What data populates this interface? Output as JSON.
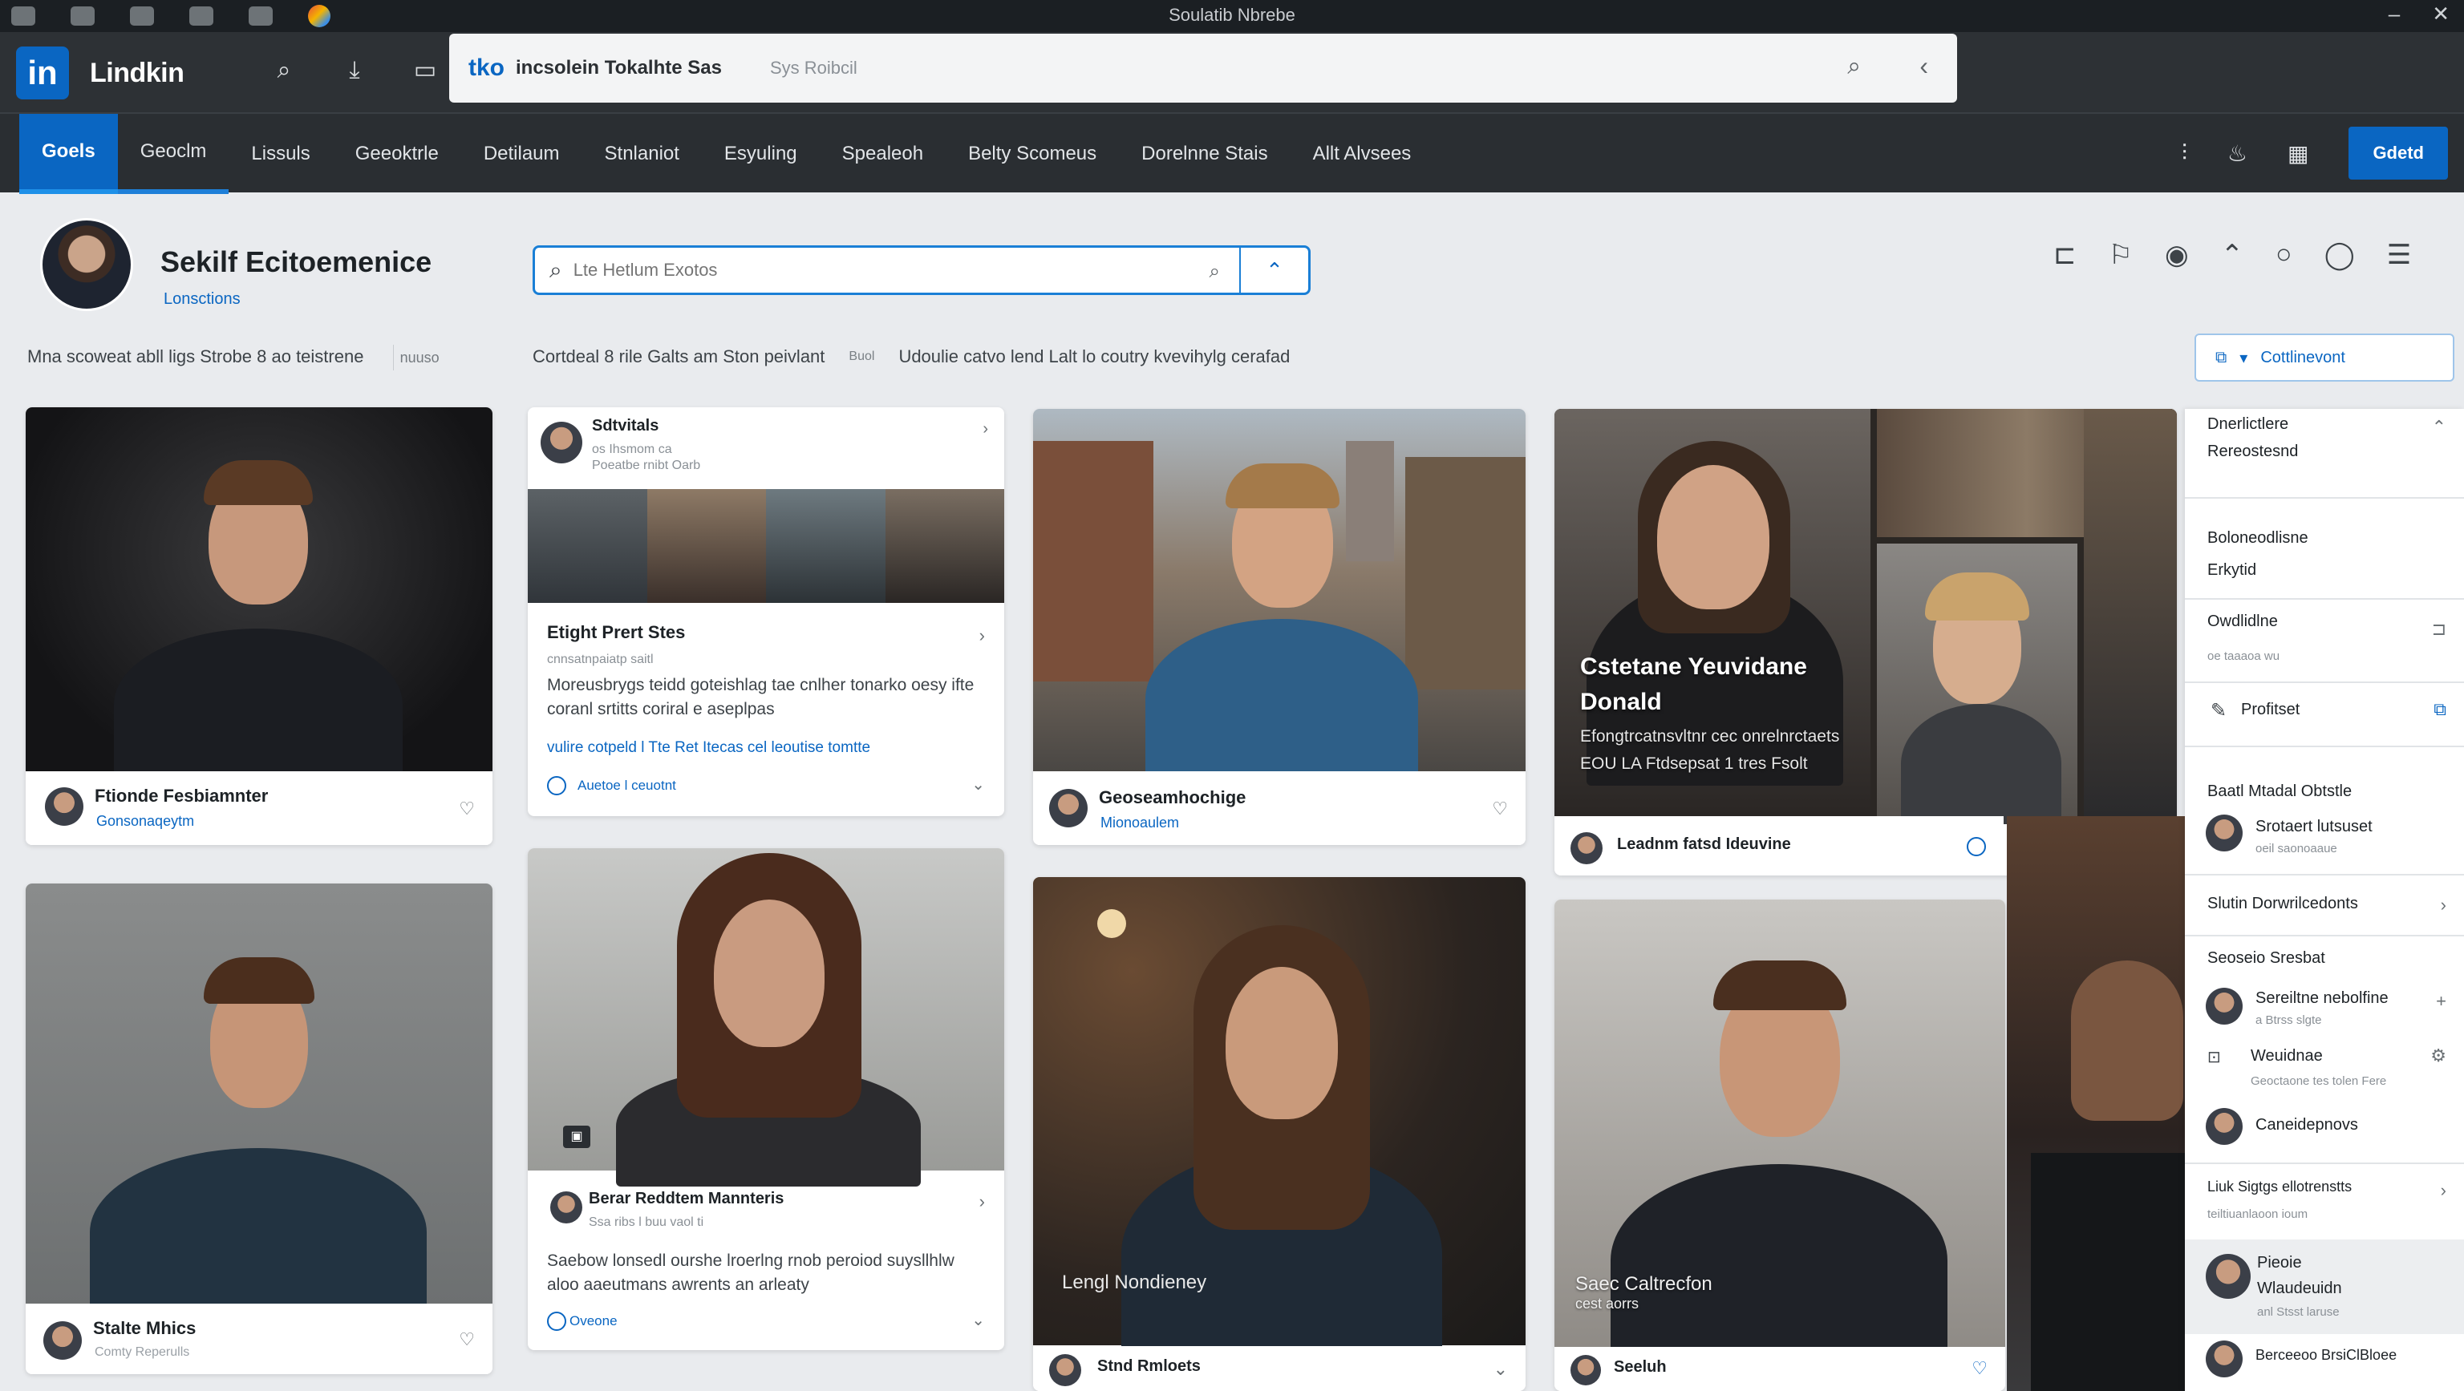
{
  "os": {
    "title": "Soulatib Nbrebe"
  },
  "app": {
    "logo_text": "in",
    "name": "Lindkin",
    "url_badge": "tko",
    "url_text": "incsolein Tokalhte Sas",
    "url_sub": "Sys Roibcil"
  },
  "nav": {
    "tabs": [
      "Goels",
      "Geoclm",
      "Lissuls",
      "Geeoktrle",
      "Detilaum",
      "Stnlaniot",
      "Esyuling",
      "Spealeoh",
      "Belty Scomeus",
      "Dorelnne Stais",
      "Allt Alvsees"
    ],
    "primary_button": "Gdetd"
  },
  "profile": {
    "name": "Sekilf Ecitoemenice",
    "subtitle": "Lonsctions",
    "strip_text": "Mna scoweat abll ligs Strobe 8 ao teistrene",
    "strip_tag": "nuuso"
  },
  "search": {
    "placeholder": "Lte Hetlum Exotos"
  },
  "crumbs": {
    "left": "Cortdeal 8 rile Galts am Ston peivlant",
    "small": "Buol",
    "right": "Udoulie catvo lend Lalt lo coutry kvevihylg cerafad"
  },
  "connect_button": "Cottlinevont",
  "cards": {
    "c1": {
      "name": "Ftionde Fesbiamnter",
      "sub": "Gonsonaqeytm"
    },
    "c2": {
      "name": "Stalte Mhics",
      "sub": "Comty Reperulls"
    },
    "post1": {
      "author": "Sdtvitals",
      "author_sub": "os Ihsmom ca",
      "author_sub2": "Poeatbe rnibt Oarb",
      "title": "Etight Prert Stes",
      "meta": "cnnsatnpaiatp saitl",
      "body": "Moreusbrygs teidd goteishlag tae cnlher tonarko oesy ifte coranl srtitts coriral e aseplpas",
      "link": "vulire cotpeld l Tte Ret Itecas cel leoutise tomtte",
      "action": "Auetoe l ceuotnt"
    },
    "post2": {
      "author": "Berar Reddtem Mannteris",
      "author_sub": "Ssa ribs l buu vaol ti",
      "body": "Saebow lonsedl ourshe lroerlng rnob peroiod suysllhlw aloo aaeutmans awrents an arleaty",
      "action": "Oveone"
    },
    "c3": {
      "name": "Geoseamhochige",
      "sub": "Mionoaulem"
    },
    "c4": {
      "name": "Stnd Rmloets",
      "overlay": "Lengl Nondieney"
    },
    "feature": {
      "title_line1": "Cstetane Yeuvidane",
      "title_line2": "Donald",
      "desc_line1": "Efongtrcatnsvltnr cec onrelnrctaets",
      "desc_line2": "EOU LA Ftdsepsat 1 tres Fsolt",
      "foot_name": "Leadnm fatsd Ideuvine"
    },
    "c5": {
      "name": "Seeluh",
      "overlay_line1": "Saec Caltrecfon",
      "overlay_line2": "cest aorrs"
    }
  },
  "right_panel": {
    "items": [
      {
        "label": "Dnerlictlere",
        "sub": "Rereostesnd"
      },
      {
        "label": "Boloneodlisne",
        "sub": "Erkytid"
      },
      {
        "label": "Owdlidlne",
        "sub": "oe taaaoa wu"
      },
      {
        "label": "Profitset"
      },
      {
        "label": "Baatl Mtadal Obtstle"
      },
      {
        "label": "Srotaert lutsuset",
        "sub": "oeil saonoaaue"
      },
      {
        "label": "Slutin Dorwrilcedonts"
      },
      {
        "label": "Seoseio Sresbat"
      },
      {
        "label": "Sereiltne nebolfine",
        "sub": "a Btrss slgte"
      },
      {
        "label": "Weuidnae",
        "sub": "Geoctaone tes tolen Fere"
      },
      {
        "label": "Caneidepnovs"
      },
      {
        "label": "Liuk Sigtgs ellotrenstts",
        "sub": "teiltiuanlaoon ioum"
      },
      {
        "label": "Pieoie",
        "sub": "Wlaudeuidn",
        "sub2": "anl Stsst laruse"
      },
      {
        "label": "Berceeoo BrsiClBloee"
      }
    ]
  },
  "colors": {
    "brand": "#0a66c2",
    "topbar": "#2d3135",
    "nav": "#2a2e32",
    "page": "#e9ebee"
  }
}
